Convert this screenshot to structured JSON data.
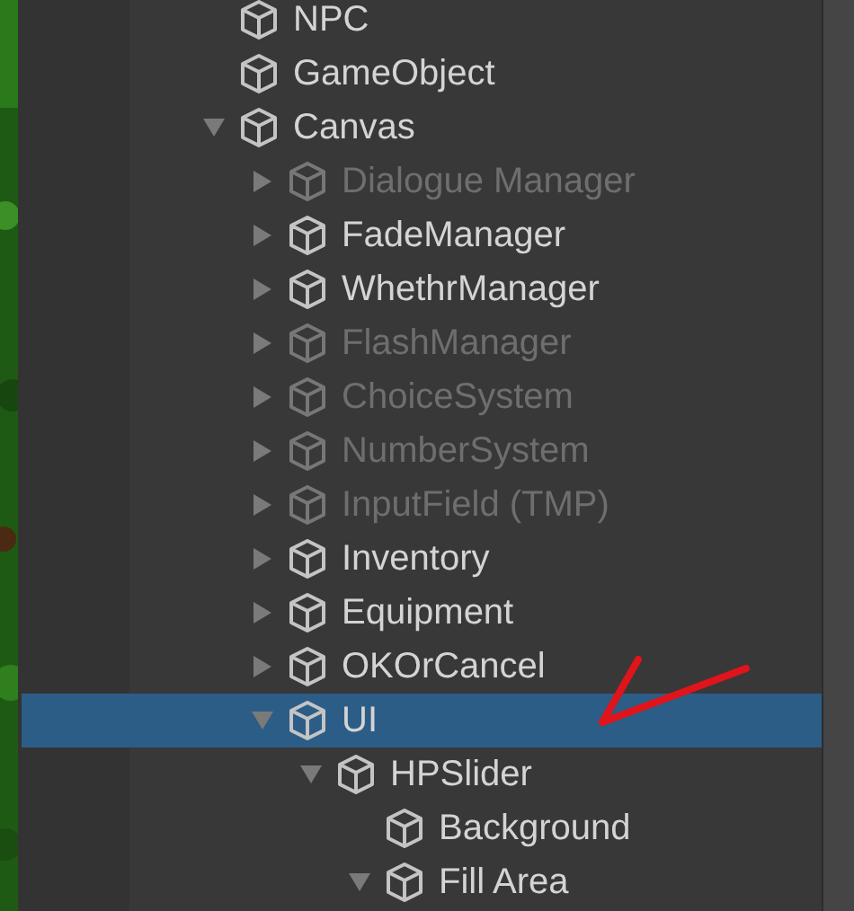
{
  "hierarchy": {
    "items": [
      {
        "name": "NPC",
        "active": true,
        "selected": false
      },
      {
        "name": "GameObject",
        "active": true,
        "selected": false
      },
      {
        "name": "Canvas",
        "active": true,
        "selected": false,
        "expanded": true,
        "children": [
          {
            "name": "Dialogue Manager",
            "active": false,
            "selected": false,
            "expanded": false
          },
          {
            "name": "FadeManager",
            "active": true,
            "selected": false,
            "expanded": false
          },
          {
            "name": "WhethrManager",
            "active": true,
            "selected": false,
            "expanded": false
          },
          {
            "name": "FlashManager",
            "active": false,
            "selected": false,
            "expanded": false
          },
          {
            "name": "ChoiceSystem",
            "active": false,
            "selected": false,
            "expanded": false
          },
          {
            "name": "NumberSystem",
            "active": false,
            "selected": false,
            "expanded": false
          },
          {
            "name": "InputField (TMP)",
            "active": false,
            "selected": false,
            "expanded": false
          },
          {
            "name": "Inventory",
            "active": true,
            "selected": false,
            "expanded": false
          },
          {
            "name": "Equipment",
            "active": true,
            "selected": false,
            "expanded": false
          },
          {
            "name": "OKOrCancel",
            "active": true,
            "selected": false,
            "expanded": false
          },
          {
            "name": "UI",
            "active": true,
            "selected": true,
            "expanded": true,
            "children": [
              {
                "name": "HPSlider",
                "active": true,
                "selected": false,
                "expanded": true,
                "children": [
                  {
                    "name": "Background",
                    "active": true,
                    "selected": false
                  },
                  {
                    "name": "Fill Area",
                    "active": true,
                    "selected": false,
                    "expanded": true
                  }
                ]
              }
            ]
          }
        ]
      }
    ]
  }
}
